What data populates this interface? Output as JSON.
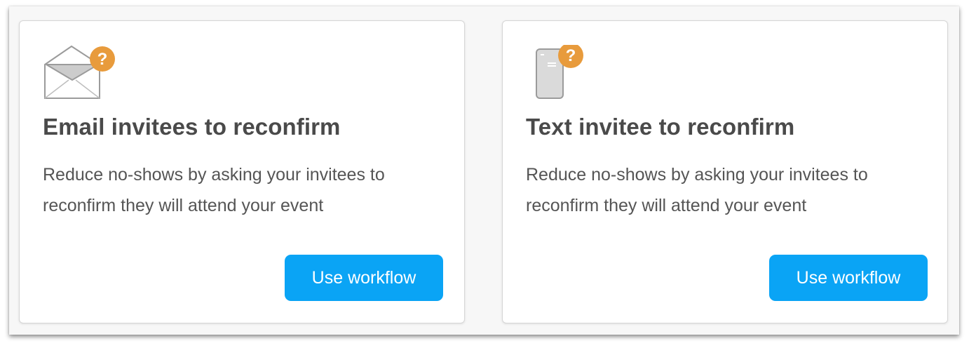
{
  "cards": [
    {
      "icon": "email-question-icon",
      "title": "Email invitees to reconfirm",
      "description": "Reduce no-shows by asking your invitees to reconfirm they will attend your event",
      "button_label": "Use workflow"
    },
    {
      "icon": "phone-question-icon",
      "title": "Text invitee to reconfirm",
      "description": "Reduce no-shows by asking your invitees to reconfirm they will attend your event",
      "button_label": "Use workflow"
    }
  ],
  "colors": {
    "accent": "#0aa4f5",
    "badge": "#e89b3c",
    "title": "#4a4a4a",
    "text": "#555555"
  }
}
